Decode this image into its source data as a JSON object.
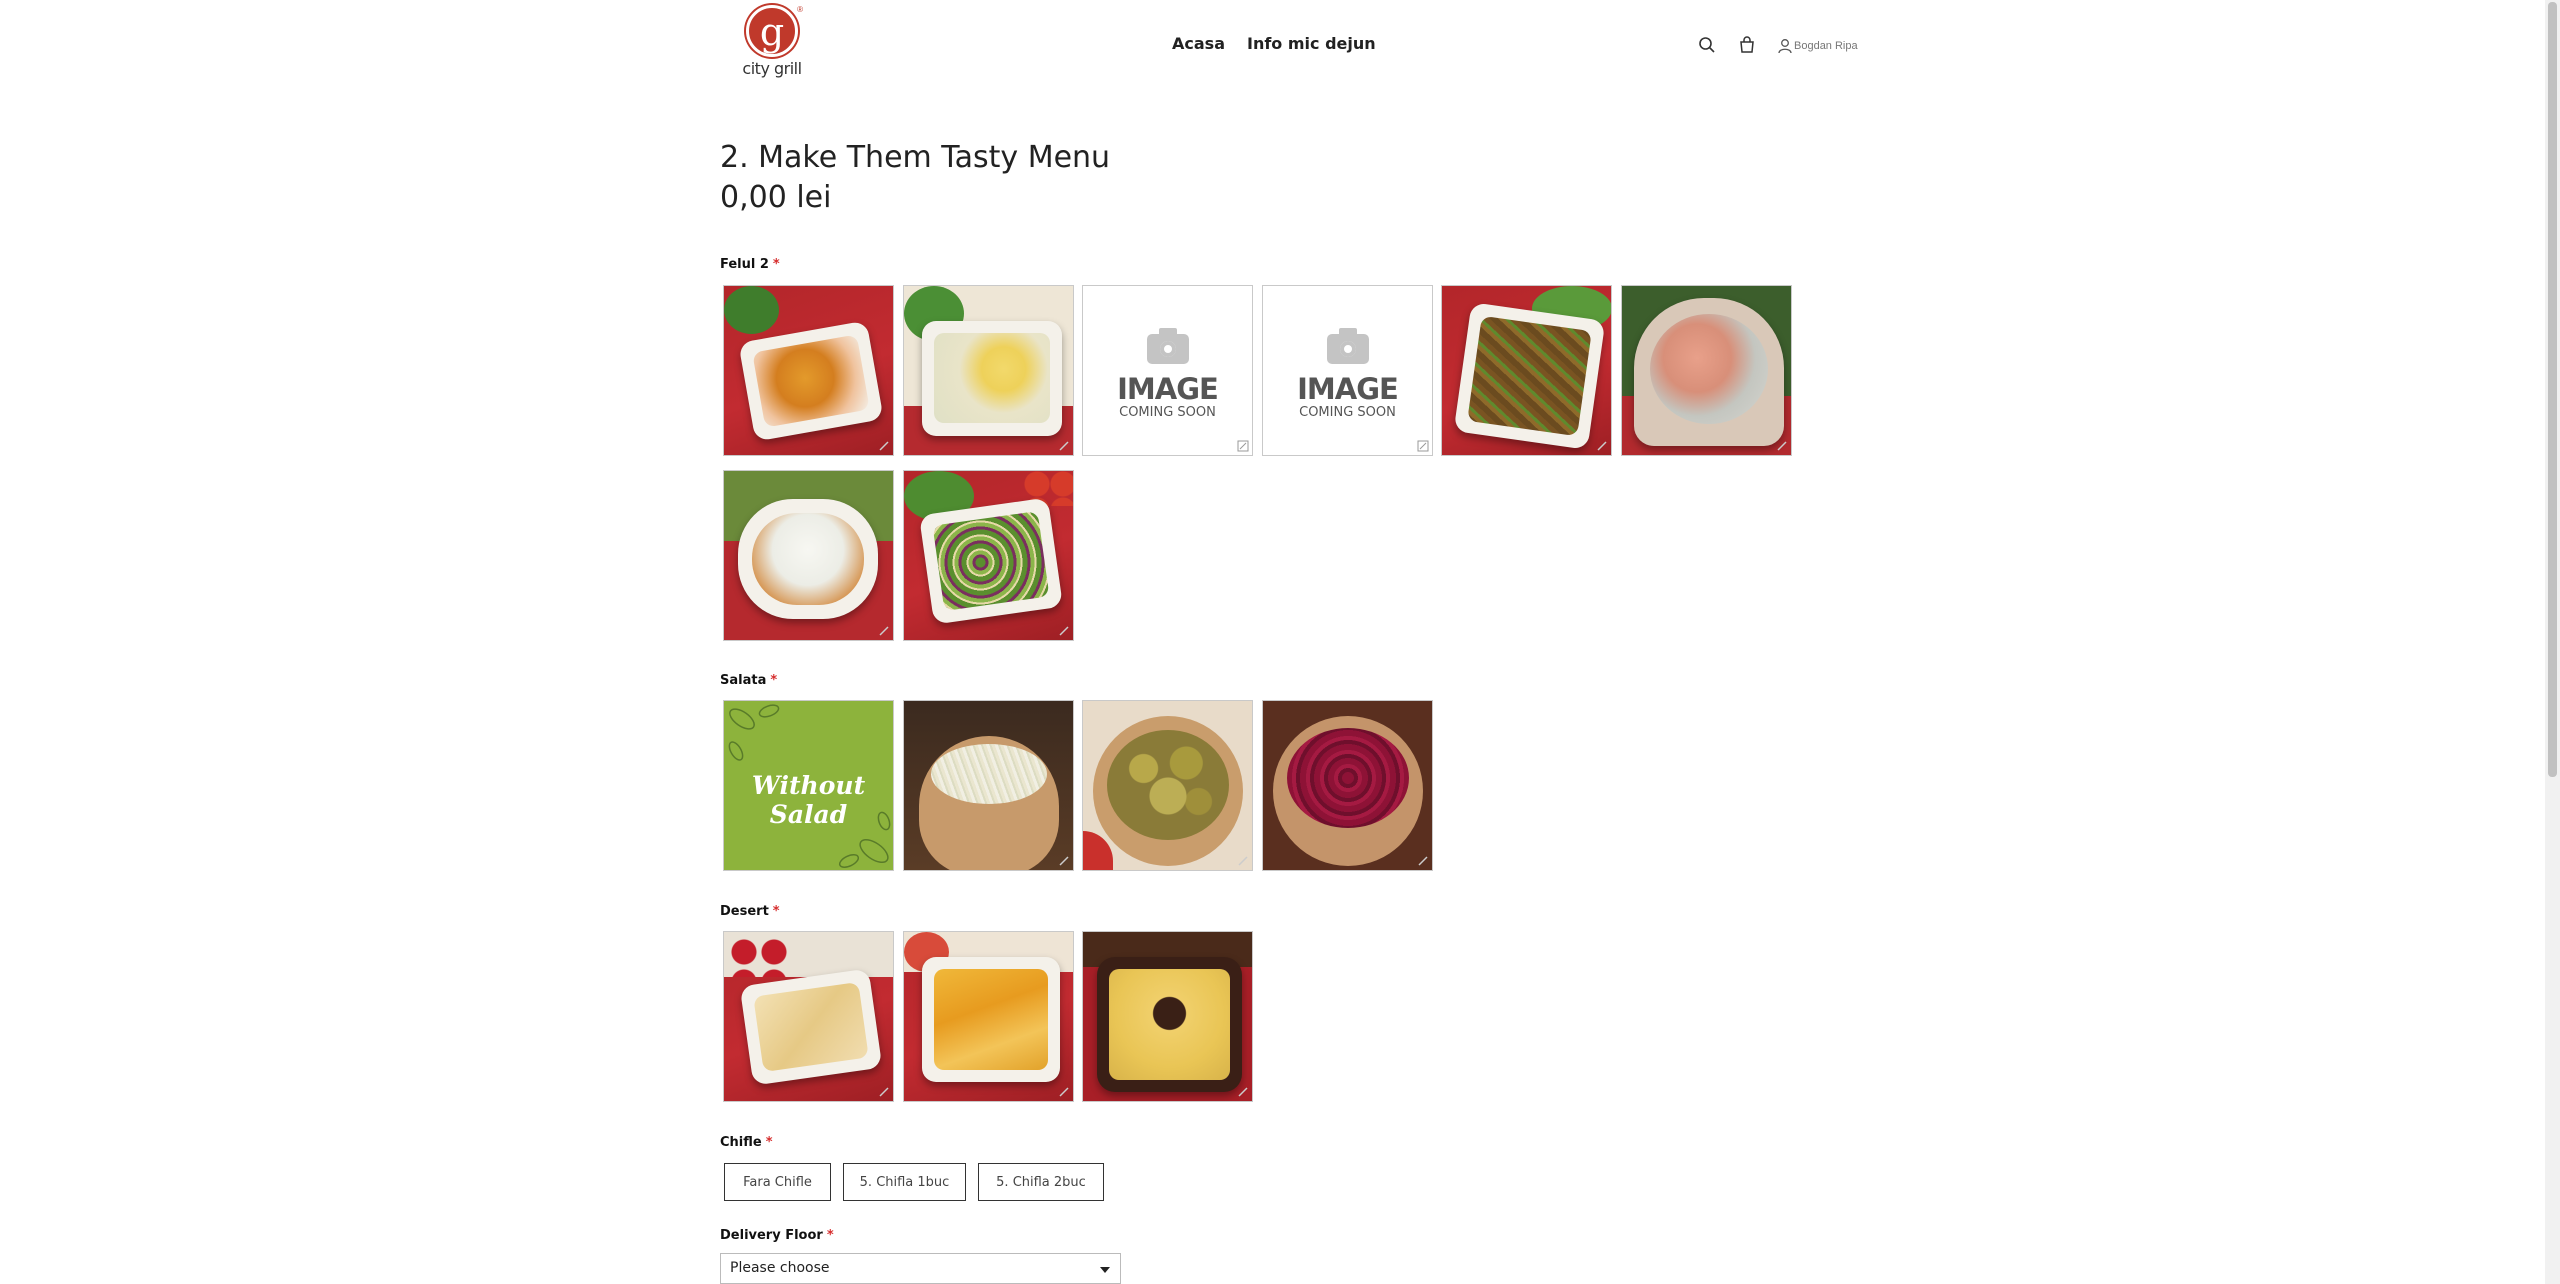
{
  "header": {
    "logo_text": "city grill",
    "logo_letter": "g",
    "logo_reg": "®",
    "nav": [
      {
        "label": "Acasa"
      },
      {
        "label": "Info mic dejun"
      }
    ],
    "user_name": "Bogdan Ripa"
  },
  "product": {
    "title": "2. Make Them Tasty Menu",
    "price": "0,00 lei"
  },
  "sections": {
    "felul2": {
      "label": "Felul 2",
      "required": "*"
    },
    "salata": {
      "label": "Salata",
      "required": "*"
    },
    "desert": {
      "label": "Desert",
      "required": "*"
    },
    "chifle": {
      "label": "Chifle",
      "required": "*"
    },
    "delivery": {
      "label": "Delivery Floor",
      "required": "*"
    }
  },
  "placeholder": {
    "line1": "IMAGE",
    "line2": "COMING SOON"
  },
  "salata_without": "Without Salad",
  "chifle_options": [
    "Fara Chifle",
    "5. Chifla 1buc",
    "5. Chifla 2buc"
  ],
  "delivery_select": {
    "value": "Please choose"
  },
  "colors": {
    "accent_red": "#c0392b",
    "required_red": "#d62d2d",
    "salad_green": "#8db33c"
  }
}
